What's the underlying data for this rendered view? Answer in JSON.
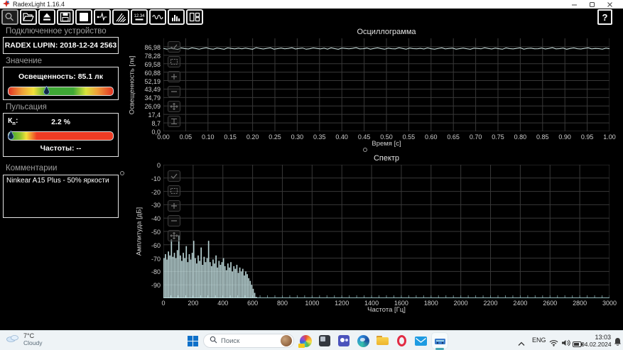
{
  "window": {
    "title": "RadexLight 1.16.4",
    "help_button": "?"
  },
  "toolbar": {
    "buttons": [
      "magnifier",
      "open-folder",
      "eject",
      "save",
      "stop",
      "pulse-trace",
      "brush-fan",
      "numeric-display",
      "waveform-view",
      "spectrum-view",
      "layout-columns"
    ],
    "numeric_display_text": "12.34"
  },
  "device_section": {
    "header": "Подключенное устройство",
    "device_name": "RADEX LUPIN: 2018-12-24 2563"
  },
  "value_section": {
    "header": "Значение",
    "reading_label": "Освещенность: 85.1 лк",
    "marker_percent": 36
  },
  "pulsation_section": {
    "header": "Пульсация",
    "kp_base": "К",
    "kp_sub": "п",
    "kp_suffix": ":",
    "kp_value": "2.2 %",
    "frequencies_label": "Частоты: --",
    "marker_percent": 2
  },
  "comments_section": {
    "header": "Комментарии",
    "text": "Ninkear A15 Plus - 50% яркости"
  },
  "chart_tools": {
    "oscillogram": [
      "select",
      "window",
      "zoom-in",
      "zoom-out",
      "pan",
      "axis"
    ],
    "spectrum": [
      "select",
      "window",
      "zoom-in",
      "zoom-out",
      "pan"
    ]
  },
  "chart_data": [
    {
      "type": "line",
      "title": "Осциллограмма",
      "xlabel": "Время [с]",
      "ylabel": "Освещенность [лк]",
      "xlim": [
        0,
        1
      ],
      "ylim": [
        0,
        95.68
      ],
      "grid": true,
      "x_ticks": [
        "0.00",
        "0.05",
        "0.10",
        "0.15",
        "0.20",
        "0.25",
        "0.30",
        "0.35",
        "0.40",
        "0.45",
        "0.50",
        "0.55",
        "0.60",
        "0.65",
        "0.70",
        "0.75",
        "0.80",
        "0.85",
        "0.90",
        "0.95",
        "1.00"
      ],
      "y_ticks": [
        "86,98",
        "78,28",
        "69,58",
        "60,88",
        "52,19",
        "43,49",
        "34,79",
        "26,09",
        "17,4",
        "8,7",
        "0,0"
      ],
      "y_tick_values": [
        86.98,
        78.28,
        69.58,
        60.88,
        52.19,
        43.49,
        34.79,
        26.09,
        17.4,
        8.7,
        0
      ],
      "series": [
        {
          "name": "illuminance",
          "color": "#d8efec",
          "values": [
            85.2,
            84.6,
            85.5,
            85.0,
            84.3,
            85.8,
            85.1,
            84.7,
            85.9,
            85.2,
            84.5,
            85.4,
            86.0,
            85.0,
            84.6,
            85.6,
            85.1,
            84.4,
            85.8,
            85.3,
            84.8,
            85.5,
            84.9,
            85.7,
            85.0,
            84.5,
            86.1,
            85.2,
            84.7,
            85.4,
            85.9,
            84.6,
            85.1,
            85.6,
            84.9,
            85.3,
            86.0,
            84.7,
            85.2,
            85.7,
            84.5,
            85.0,
            85.8,
            85.3,
            84.8,
            85.5,
            84.6,
            85.9,
            85.1,
            84.4,
            85.6,
            85.2,
            84.9,
            85.4,
            86.1,
            84.8,
            85.0,
            85.7,
            84.6,
            85.3,
            85.9,
            85.1,
            84.5,
            85.5,
            85.0,
            84.8,
            86.0,
            85.2,
            84.6,
            85.6,
            85.1,
            84.9,
            85.4,
            84.7,
            85.8,
            85.0,
            84.5,
            85.3,
            85.9,
            84.8,
            85.2,
            85.6,
            84.6,
            85.1,
            85.7,
            85.0,
            84.4,
            85.5,
            85.2,
            84.9,
            86.0,
            85.3,
            84.7,
            85.6,
            85.0,
            84.5,
            85.8,
            85.1,
            84.8,
            85.4,
            85.9,
            84.6,
            85.2,
            85.5,
            84.9,
            85.0,
            85.7,
            84.7,
            85.3,
            86.1,
            84.8,
            85.1,
            85.6,
            84.5,
            85.2,
            85.8,
            85.0,
            84.7,
            85.4,
            85.9,
            84.8,
            85.3,
            85.1,
            84.6,
            85.5,
            85.0
          ]
        }
      ]
    },
    {
      "type": "bar",
      "title": "Спектр",
      "xlabel": "Частота [Гц]",
      "ylabel": "Амплитуда [дБ]",
      "xlim": [
        0,
        3000
      ],
      "ylim": [
        -100,
        0
      ],
      "grid": true,
      "bar_color": "#c9e6e7",
      "x_tick_values": [
        0,
        200,
        400,
        600,
        800,
        1000,
        1200,
        1400,
        1600,
        1800,
        2000,
        2200,
        2400,
        2600,
        2800,
        3000
      ],
      "y_tick_values": [
        0,
        -10,
        -20,
        -30,
        -40,
        -50,
        -60,
        -70,
        -80,
        -90
      ],
      "freq_step": 10,
      "values": [
        -70,
        -67,
        -71,
        -65,
        -68,
        -56,
        -69,
        -66,
        -70,
        -64,
        -53,
        -68,
        -72,
        -66,
        -70,
        -61,
        -73,
        -67,
        -71,
        -66,
        -57,
        -70,
        -74,
        -68,
        -72,
        -62,
        -75,
        -69,
        -73,
        -70,
        -57,
        -73,
        -76,
        -71,
        -74,
        -68,
        -77,
        -72,
        -75,
        -73,
        -70,
        -76,
        -79,
        -74,
        -77,
        -73,
        -80,
        -76,
        -78,
        -75,
        -81,
        -77,
        -80,
        -78,
        -83,
        -80,
        -82,
        -85,
        -87,
        -90,
        -93,
        -96,
        -99,
        -100
      ]
    }
  ],
  "taskbar": {
    "weather": {
      "temp": "7°C",
      "condition": "Cloudy"
    },
    "search": {
      "placeholder": "Поиск"
    },
    "apps": [
      "Paint",
      "Photos",
      "Teams",
      "Edge",
      "Explorer",
      "Opera",
      "Mail",
      "RadexLight"
    ],
    "active_app": "RadexLight",
    "tray": {
      "lang": "ENG",
      "time": "13:03",
      "date": "04.02.2024"
    }
  },
  "colors": {
    "signal": "#d8efec",
    "spectrum_bar": "#c9e6e7",
    "grid": "#383838",
    "taskbar_bg": "#eef3f6",
    "accent_active": "#49a8b5"
  }
}
